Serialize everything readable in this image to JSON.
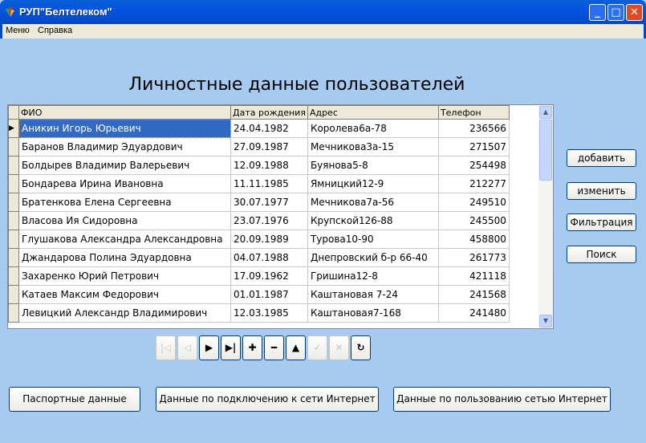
{
  "window": {
    "title": "РУП\"Белтелеком\"",
    "minimize": "_",
    "maximize": "□",
    "close": "✕"
  },
  "menu": [
    "Меню",
    "Справка"
  ],
  "heading": "Личностные данные пользователей",
  "table": {
    "columns": [
      "ФИО",
      "Дата рождения",
      "Адрес",
      "Телефон"
    ],
    "rows": [
      [
        "Аникин Игорь Юрьевич",
        "24.04.1982",
        "Королева6а-78",
        "236566"
      ],
      [
        "Баранов Владимир Эдуардович",
        "27.09.1987",
        "Мечникова3а-15",
        "271507"
      ],
      [
        "Болдырев Владимир Валерьевич",
        "12.09.1988",
        "Буянова5-8",
        "254498"
      ],
      [
        "Бондарева Ирина Ивановна",
        "11.11.1985",
        "Ямницкий12-9",
        "212277"
      ],
      [
        "Братенкова Елена Сергеевна",
        "30.07.1977",
        "Мечникова7а-56",
        "249510"
      ],
      [
        "Власова Ия Сидоровна",
        "23.07.1976",
        "Крупской126-88",
        "245500"
      ],
      [
        "Глушакова Александра Александровна",
        "20.09.1989",
        "Турова10-90",
        "458800"
      ],
      [
        "Джандарова Полина Эдуардовна",
        "04.07.1988",
        "Днепровский б-р 66-40",
        "261773"
      ],
      [
        "Захаренко Юрий Петрович",
        "17.09.1962",
        "Гришина12-8",
        "421118"
      ],
      [
        "Катаев Максим Федорович",
        "01.01.1987",
        "Каштановая 7-24",
        "241568"
      ],
      [
        "Левицкий Александр Владимирович",
        "12.03.1985",
        "Каштановая7-168",
        "241480"
      ]
    ],
    "selected_row": 0
  },
  "side_buttons": {
    "add": "добавить",
    "edit": "изменить",
    "filter": "Фильтрация",
    "search": "Поиск"
  },
  "navigator": [
    {
      "name": "first",
      "glyph": "|◁",
      "enabled": false
    },
    {
      "name": "prior",
      "glyph": "◁",
      "enabled": false
    },
    {
      "name": "next",
      "glyph": "▶",
      "enabled": true
    },
    {
      "name": "last",
      "glyph": "▶|",
      "enabled": true
    },
    {
      "name": "insert",
      "glyph": "✚",
      "enabled": true
    },
    {
      "name": "delete",
      "glyph": "━",
      "enabled": true
    },
    {
      "name": "edit",
      "glyph": "▲",
      "enabled": true
    },
    {
      "name": "post",
      "glyph": "✓",
      "enabled": false
    },
    {
      "name": "cancel",
      "glyph": "✕",
      "enabled": false
    },
    {
      "name": "refresh",
      "glyph": "↻",
      "enabled": true
    }
  ],
  "bottom_buttons": {
    "passport": "Паспортные данные",
    "connection": "Данные по подключению к сети Интернет",
    "usage": "Данные по пользованию сетью Интернет"
  }
}
